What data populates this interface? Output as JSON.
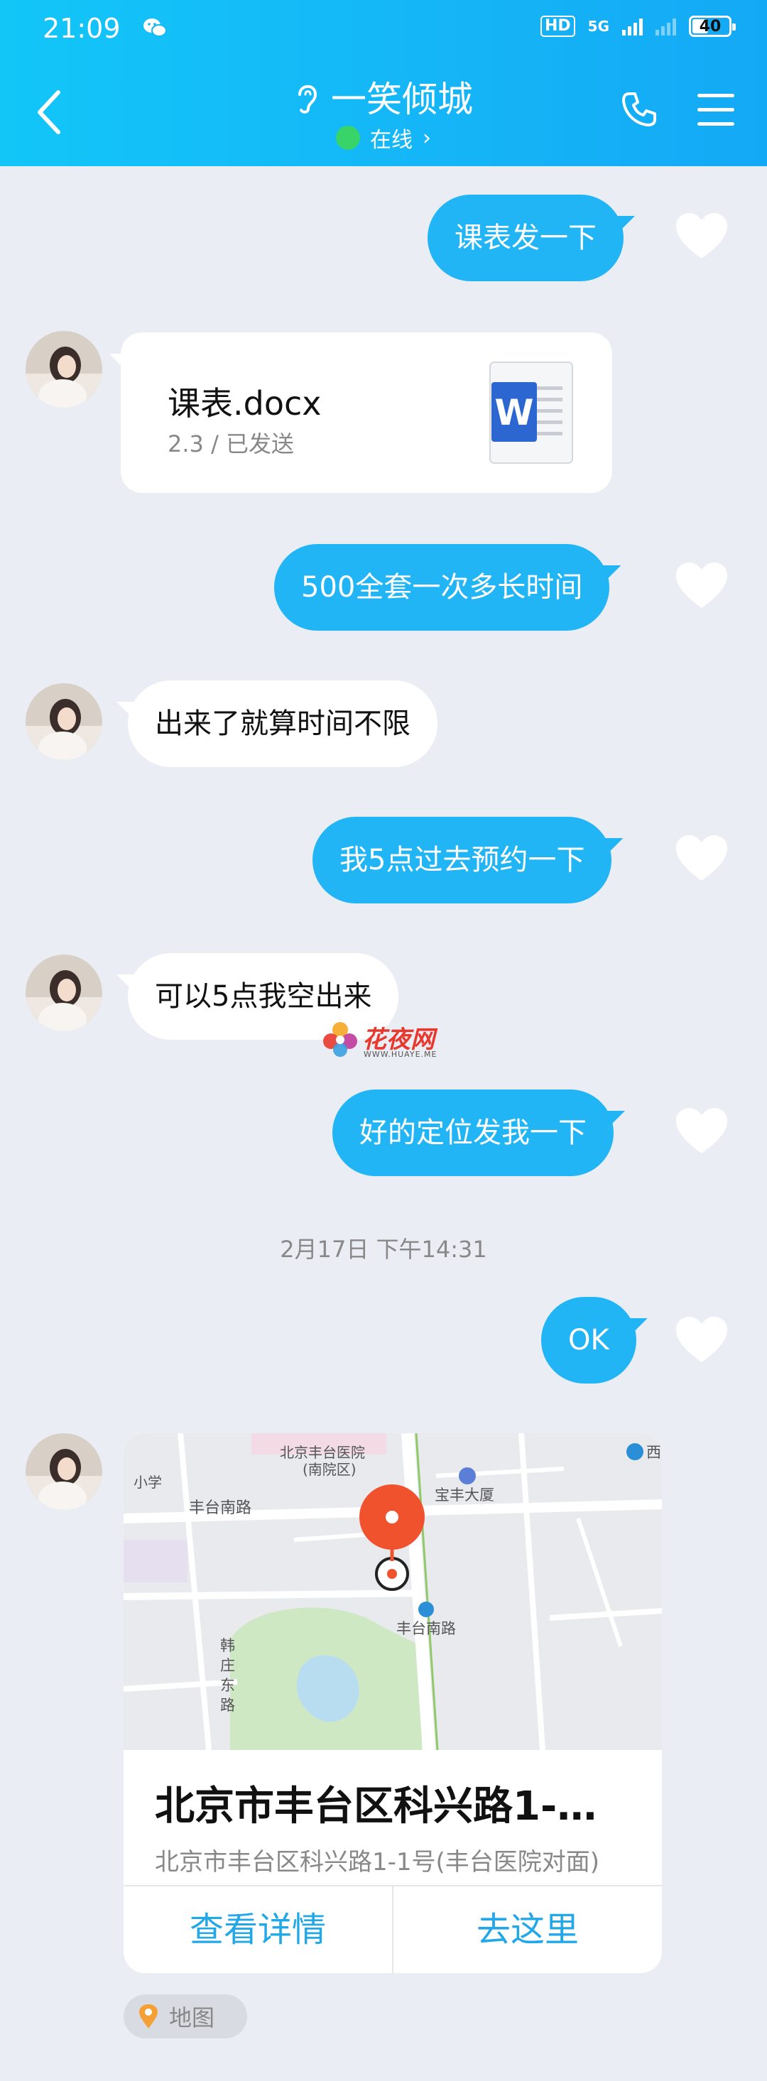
{
  "status_bar": {
    "time": "21:09",
    "hd": "HD",
    "network": "5G",
    "battery": "40"
  },
  "header": {
    "title": "一笑倾城",
    "status": "在线",
    "chevron": "›"
  },
  "messages": [
    {
      "side": "me",
      "text": "课表发一下"
    },
    {
      "side": "them",
      "type": "file",
      "file_name": "课表.docx",
      "file_meta": "2.3 / 已发送",
      "icon": "word-doc-icon"
    },
    {
      "side": "me",
      "text": "500全套一次多长时间"
    },
    {
      "side": "them",
      "text": "出来了就算时间不限"
    },
    {
      "side": "me",
      "text": "我5点过去预约一下"
    },
    {
      "side": "them",
      "text": "可以5点我空出来"
    },
    {
      "side": "me",
      "text": "好的定位发我一下"
    },
    {
      "side": "me",
      "text": "OK"
    },
    {
      "side": "them",
      "type": "location"
    }
  ],
  "timestamp": "2月17日 下午14:31",
  "watermark": {
    "brand": "花夜网",
    "url": "WWW.HUAYE.ME"
  },
  "location": {
    "title": "北京市丰台区科兴路1-…",
    "address": "北京市丰台区科兴路1-1号(丰台医院对面)",
    "btn_details": "查看详情",
    "btn_go": "去这里",
    "tag": "地图",
    "map_labels": {
      "hospital": "北京丰台医院",
      "hospital_sub": "(南院区)",
      "school": "小学",
      "road1": "丰台南路",
      "building": "宝丰大厦",
      "station": "丰台南路",
      "road_vertical": "韩庄东路",
      "west": "西"
    }
  },
  "colors": {
    "header_start": "#12c6f8",
    "header_end": "#14a9f5",
    "bubble_me": "#22b5f5",
    "bubble_them": "#ffffff",
    "background": "#ebedf5",
    "accent_link": "#22a8e8",
    "pin": "#f0522e",
    "online": "#38d46a"
  }
}
